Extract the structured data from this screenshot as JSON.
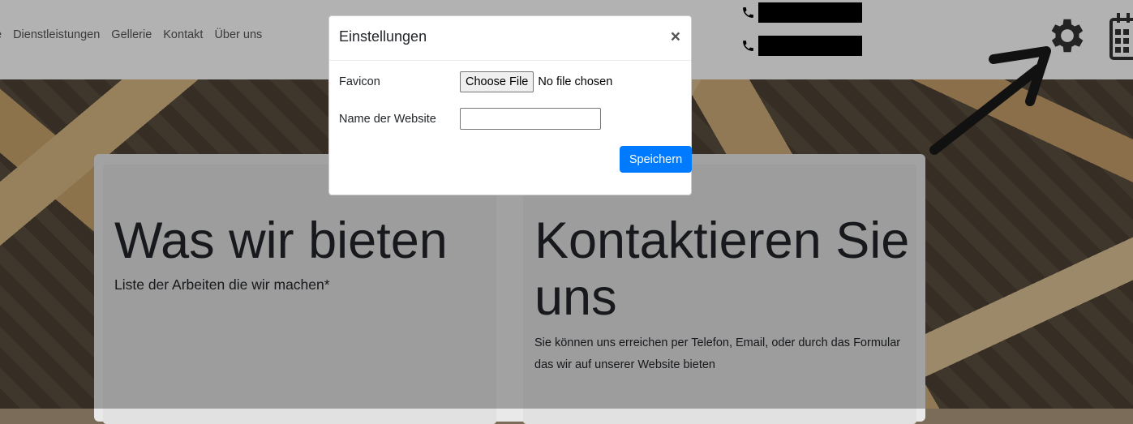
{
  "nav": {
    "links": [
      "e",
      "Dienstleistungen",
      "Gellerie",
      "Kontakt",
      "Über uns"
    ]
  },
  "header_icons": {
    "phone_icon": "phone-icon",
    "gear_icon": "gear-icon",
    "calendar_icon": "calendar-icon"
  },
  "content": {
    "left_title": "Was wir bieten",
    "left_subtitle": "Liste der Arbeiten die wir machen*",
    "right_title": "Kontaktieren Sie uns",
    "right_text": "Sie können uns erreichen per Telefon, Email, oder durch das Formular das wir auf unserer Website bieten"
  },
  "modal": {
    "title": "Einstellungen",
    "close_label": "×",
    "favicon_label": "Favicon",
    "file_button": "Choose File",
    "file_status": "No file chosen",
    "name_label": "Name der Website",
    "name_value": "",
    "save_label": "Speichern",
    "accent": "#007bff"
  }
}
